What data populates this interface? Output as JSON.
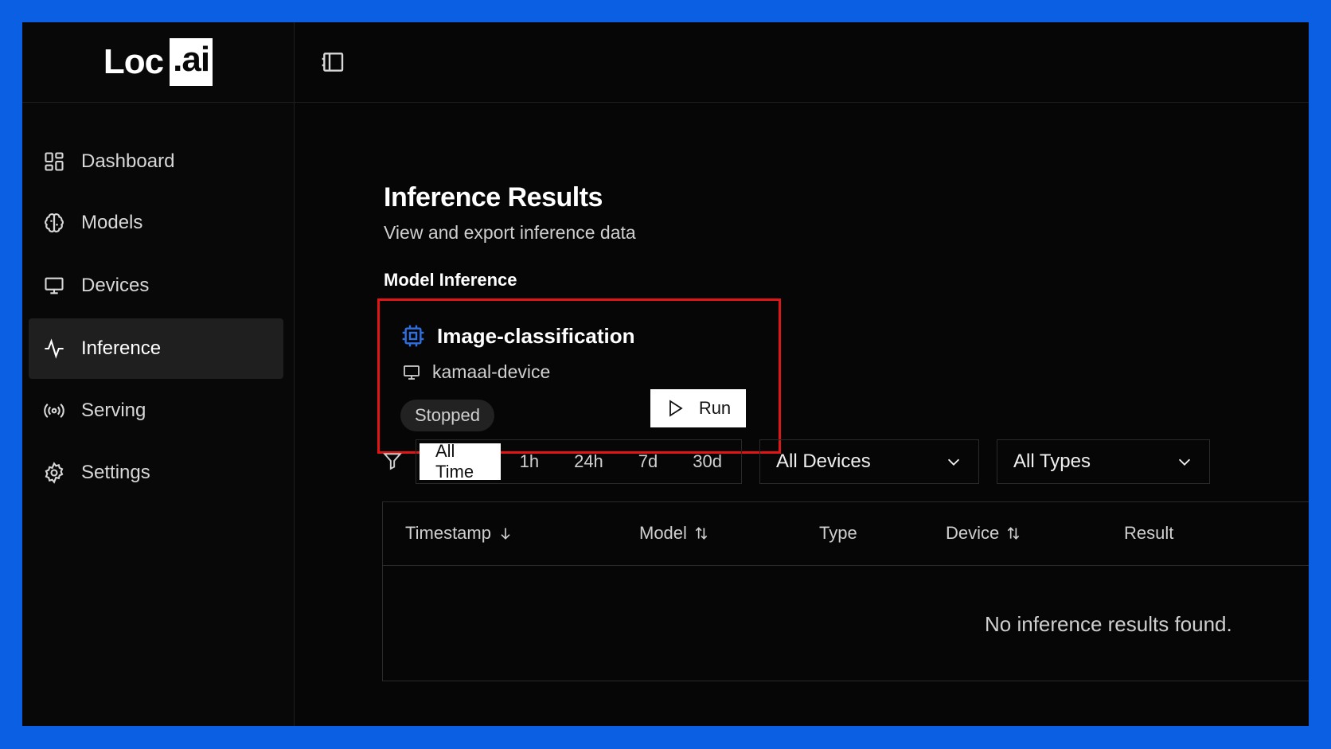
{
  "app": {
    "logo_main": "Loc",
    "logo_accent": ".ai"
  },
  "sidebar": {
    "items": [
      {
        "label": "Dashboard",
        "icon": "dashboard-grid-icon",
        "active": false
      },
      {
        "label": "Models",
        "icon": "brain-icon",
        "active": false
      },
      {
        "label": "Devices",
        "icon": "monitor-icon",
        "active": false
      },
      {
        "label": "Inference",
        "icon": "activity-pulse-icon",
        "active": true
      },
      {
        "label": "Serving",
        "icon": "broadcast-icon",
        "active": false
      },
      {
        "label": "Settings",
        "icon": "gear-icon",
        "active": false
      }
    ]
  },
  "page": {
    "title": "Inference Results",
    "subtitle": "View and export inference data",
    "section_title": "Model Inference"
  },
  "card": {
    "model_name": "Image-classification",
    "device_name": "kamaal-device",
    "status": "Stopped",
    "run_label": "Run",
    "highlight_color": "#e01515",
    "chip_icon_color": "#2f6fe0"
  },
  "filters": {
    "time_ranges": [
      "All Time",
      "1h",
      "24h",
      "7d",
      "30d"
    ],
    "selected_time": "All Time",
    "device_select": "All Devices",
    "type_select": "All Types"
  },
  "table": {
    "columns": [
      "Timestamp",
      "Model",
      "Type",
      "Device",
      "Result"
    ],
    "empty_message": "No inference results found."
  },
  "colors": {
    "frame_border": "#0a5fe3",
    "background": "#060606",
    "active_nav": "#1f1f1f"
  }
}
